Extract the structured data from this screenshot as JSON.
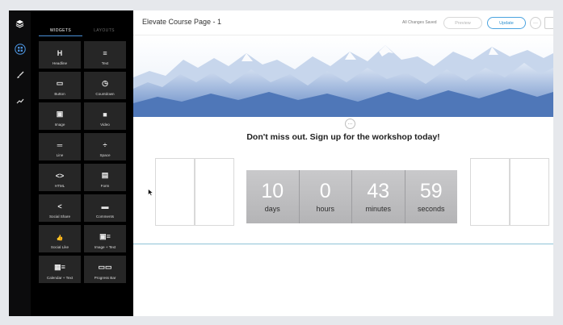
{
  "rail": {
    "icons": [
      "layers-icon",
      "widgets-grid-icon",
      "brush-icon",
      "analytics-icon"
    ]
  },
  "panel": {
    "tabs": [
      {
        "label": "WIDGETS",
        "active": true
      },
      {
        "label": "LAYOUTS",
        "active": false
      }
    ],
    "widgets": [
      {
        "label": "Headline",
        "icon": "H",
        "icon_name": "headline-icon"
      },
      {
        "label": "Text",
        "icon": "≡",
        "icon_name": "text-icon"
      },
      {
        "label": "Button",
        "icon": "▭",
        "icon_name": "button-icon"
      },
      {
        "label": "Countdown",
        "icon": "◷",
        "icon_name": "clock-icon"
      },
      {
        "label": "Image",
        "icon": "▣",
        "icon_name": "image-icon"
      },
      {
        "label": "Video",
        "icon": "■",
        "icon_name": "video-icon"
      },
      {
        "label": "Line",
        "icon": "═",
        "icon_name": "line-icon"
      },
      {
        "label": "Space",
        "icon": "÷",
        "icon_name": "space-icon"
      },
      {
        "label": "HTML",
        "icon": "<>",
        "icon_name": "code-icon"
      },
      {
        "label": "Form",
        "icon": "▤",
        "icon_name": "form-icon"
      },
      {
        "label": "Social Share",
        "icon": "<",
        "icon_name": "share-icon"
      },
      {
        "label": "Comments",
        "icon": "▬",
        "icon_name": "comments-icon"
      },
      {
        "label": "Social Like",
        "icon": "👍",
        "icon_name": "thumbs-up-icon"
      },
      {
        "label": "Image + Text",
        "icon": "▣≡",
        "icon_name": "image-text-icon"
      },
      {
        "label": "Calendar + Text",
        "icon": "▦≡",
        "icon_name": "calendar-text-icon"
      },
      {
        "label": "Progress Bar",
        "icon": "▭▭",
        "icon_name": "progress-bar-icon"
      }
    ]
  },
  "topbar": {
    "title": "Elevate Course Page - 1",
    "status": "All Changes Saved",
    "preview_label": "Preview",
    "update_label": "Update",
    "more_label": "···"
  },
  "canvas": {
    "handle_label": "···",
    "headline": "Don't miss out. Sign up for the workshop today!",
    "countdown": [
      {
        "value": "10",
        "unit": "days"
      },
      {
        "value": "0",
        "unit": "hours"
      },
      {
        "value": "43",
        "unit": "minutes"
      },
      {
        "value": "59",
        "unit": "seconds"
      }
    ]
  },
  "colors": {
    "accent": "#4aa3df",
    "panel_bg": "#000000",
    "tile_bg": "#262626",
    "countdown_bg": "#bdbdbf"
  }
}
